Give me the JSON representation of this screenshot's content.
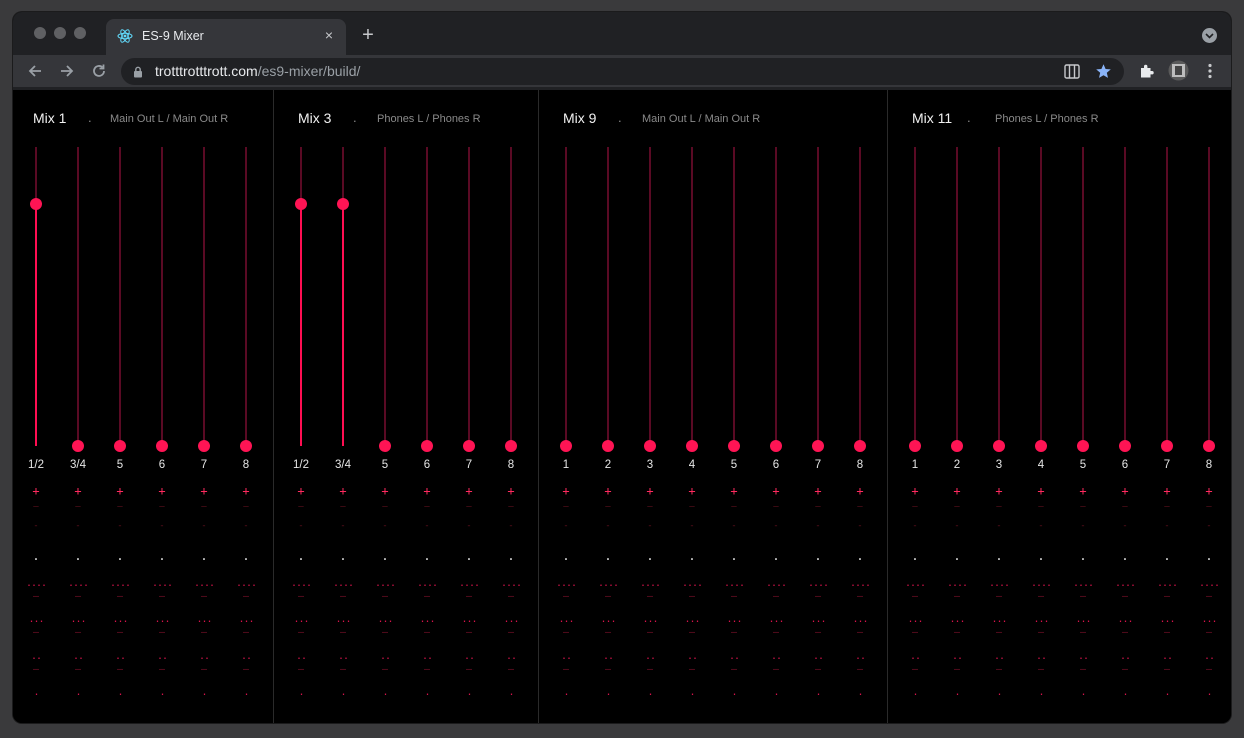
{
  "browser": {
    "tab_title": "ES-9 Mixer",
    "tab_close": "×",
    "new_tab": "+",
    "url_host": "trotttrotttrott.com",
    "url_path": "/es9-mixer/build/",
    "icons": {
      "tab_favicon": "react-icon",
      "back": "back-arrow-icon",
      "forward": "forward-arrow-icon",
      "reload": "reload-icon",
      "lock": "lock-icon",
      "piano_extension": "piano-icon",
      "bookmark": "star-icon",
      "extensions": "puzzle-icon",
      "profile": "avatar",
      "menu": "kebab-menu-icon"
    }
  },
  "mixer": {
    "colors": {
      "accent": "#ff1454",
      "track": "#5a0a24",
      "background": "#000000"
    },
    "mixes": [
      {
        "title": "Mix 1",
        "separator": ".",
        "outputs": "Main Out L / Main Out R",
        "channels": [
          {
            "label": "1/2",
            "level": 0.81
          },
          {
            "label": "3/4",
            "level": 0
          },
          {
            "label": "5",
            "level": 0
          },
          {
            "label": "6",
            "level": 0
          },
          {
            "label": "7",
            "level": 0
          },
          {
            "label": "8",
            "level": 0
          }
        ]
      },
      {
        "title": "Mix 3",
        "separator": ".",
        "outputs": "Phones L / Phones R",
        "channels": [
          {
            "label": "1/2",
            "level": 0.81
          },
          {
            "label": "3/4",
            "level": 0.81
          },
          {
            "label": "5",
            "level": 0
          },
          {
            "label": "6",
            "level": 0
          },
          {
            "label": "7",
            "level": 0
          },
          {
            "label": "8",
            "level": 0
          }
        ]
      },
      {
        "title": "Mix 9",
        "separator": ".",
        "outputs": "Main Out L / Main Out R",
        "channels": [
          {
            "label": "1",
            "level": 0
          },
          {
            "label": "2",
            "level": 0
          },
          {
            "label": "3",
            "level": 0
          },
          {
            "label": "4",
            "level": 0
          },
          {
            "label": "5",
            "level": 0
          },
          {
            "label": "6",
            "level": 0
          },
          {
            "label": "7",
            "level": 0
          },
          {
            "label": "8",
            "level": 0
          }
        ]
      },
      {
        "title": "Mix 11",
        "separator": ".",
        "outputs": "Phones L / Phones R",
        "channels": [
          {
            "label": "1",
            "level": 0
          },
          {
            "label": "2",
            "level": 0
          },
          {
            "label": "3",
            "level": 0
          },
          {
            "label": "4",
            "level": 0
          },
          {
            "label": "5",
            "level": 0
          },
          {
            "label": "6",
            "level": 0
          },
          {
            "label": "7",
            "level": 0
          },
          {
            "label": "8",
            "level": 0
          }
        ]
      }
    ],
    "channel_marks": [
      "+",
      "—",
      "-",
      ".",
      "....",
      "—",
      "...",
      "—",
      "..",
      "—",
      "."
    ]
  }
}
